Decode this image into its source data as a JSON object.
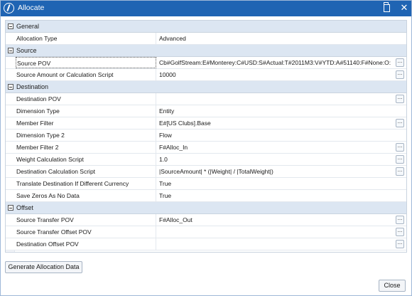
{
  "window": {
    "title": "Allocate"
  },
  "grid": {
    "sections": [
      {
        "label": "General",
        "rows": [
          {
            "name": "Allocation Type",
            "value": "Advanced",
            "has_button": false
          }
        ]
      },
      {
        "label": "Source",
        "rows": [
          {
            "name": "Source POV",
            "value": "Cb#GolfStream:E#Monterey:C#USD:S#Actual:T#2011M3:V#YTD:A#51140:F#None:O:",
            "has_button": true,
            "focused": true
          },
          {
            "name": "Source Amount or Calculation Script",
            "value": "10000",
            "has_button": true
          }
        ]
      },
      {
        "label": "Destination",
        "rows": [
          {
            "name": "Destination POV",
            "value": "",
            "has_button": true
          },
          {
            "name": "Dimension Type",
            "value": "Entity",
            "has_button": false
          },
          {
            "name": "Member Filter",
            "value": "E#[US Clubs].Base",
            "has_button": true
          },
          {
            "name": "Dimension Type 2",
            "value": "Flow",
            "has_button": false
          },
          {
            "name": "Member Filter 2",
            "value": "F#Alloc_In",
            "has_button": true
          },
          {
            "name": "Weight Calculation Script",
            "value": "1.0",
            "has_button": true
          },
          {
            "name": "Destination Calculation Script",
            "value": "|SourceAmount| * (|Weight| / |TotalWeight|)",
            "has_button": true
          },
          {
            "name": "Translate Destination If Different Currency",
            "value": "True",
            "has_button": false
          },
          {
            "name": "Save Zeros As No Data",
            "value": "True",
            "has_button": false
          }
        ]
      },
      {
        "label": "Offset",
        "rows": [
          {
            "name": "Source Transfer POV",
            "value": "F#Alloc_Out",
            "has_button": true
          },
          {
            "name": "Source Transfer Offset POV",
            "value": "",
            "has_button": true
          },
          {
            "name": "Destination Offset POV",
            "value": "",
            "has_button": true
          }
        ]
      }
    ],
    "ellipsis_label": "..."
  },
  "buttons": {
    "generate": "Generate Allocation Data",
    "close": "Close"
  },
  "icons": {
    "title": "app-logo-icon",
    "maximize": "maximize-icon",
    "close": "close-icon",
    "section_toggle": "collapse-minus-icon"
  },
  "colors": {
    "titlebar": "#1f64b3",
    "section_bg": "#dce6f2"
  }
}
